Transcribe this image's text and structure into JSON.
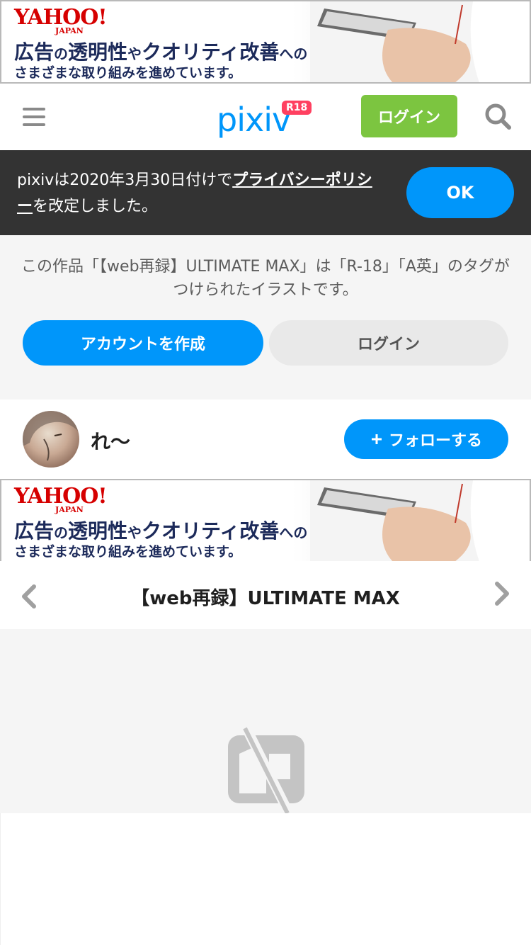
{
  "ad_banner": {
    "logo": "YAHOO!",
    "logo_sub": "JAPAN",
    "line1_a": "広告",
    "line1_b": "の",
    "line1_c": "透明性",
    "line1_d": "や",
    "line1_e": "クオリティ改善",
    "line1_f": "への",
    "line2": "さまざまな取り組みを進めています。"
  },
  "header": {
    "logo_text": "pixiv",
    "logo_badge": "R18",
    "login_label": "ログイン"
  },
  "notice": {
    "text_before": "pixivは2020年3月30日付けで",
    "link_text": "プライバシーポリシー",
    "text_after": "を改定しました。",
    "ok_label": "OK"
  },
  "gate": {
    "message": "この作品「【web再録】ULTIMATE MAX」は「R-18」「A英」のタグがつけられたイラストです。",
    "create_account_label": "アカウントを作成",
    "login_label": "ログイン"
  },
  "author": {
    "name": "れ〜",
    "follow_label": "フォローする",
    "follow_icon": "plus-icon"
  },
  "work": {
    "title": "【web再録】ULTIMATE MAX"
  },
  "colors": {
    "accent": "#0096fa",
    "login_green": "#7cc540",
    "notice_bg": "#333333",
    "r18_badge": "#ff4060"
  }
}
